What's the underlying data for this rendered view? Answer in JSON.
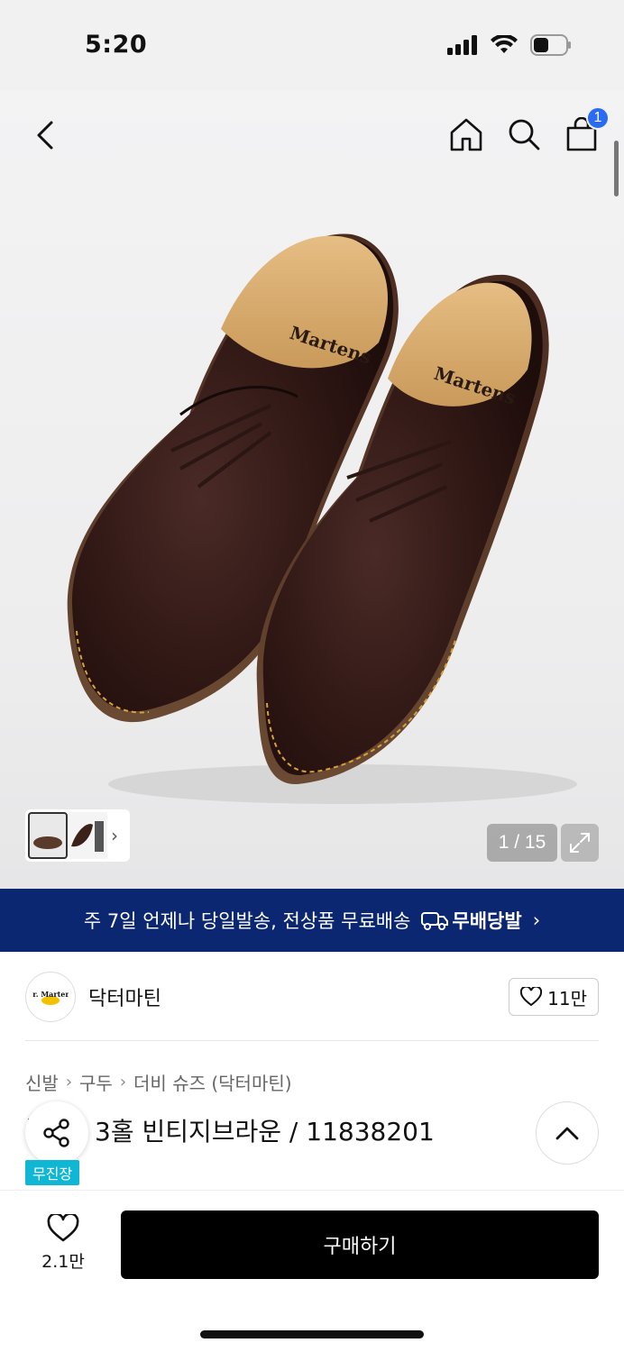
{
  "status_bar": {
    "time": "5:20"
  },
  "nav": {
    "cart_count": "1"
  },
  "gallery": {
    "counter": "1 / 15"
  },
  "promo": {
    "text": "주 7일 언제나 당일발송, 전상품 무료배송",
    "brand": "무배당발",
    "chevron": "›"
  },
  "brand": {
    "name": "닥터마틴",
    "likes": "11만",
    "logo_text": "Dr. Martens"
  },
  "breadcrumb": {
    "items": [
      "신발",
      "구두",
      "더비 슈즈 (닥터마틴)"
    ],
    "separator": "›"
  },
  "product": {
    "title_prefix": "1",
    "title": "3홀 빈티지브라운 / 11838201",
    "store_tag": "무진장"
  },
  "bottom_bar": {
    "wish_count": "2.1만",
    "buy_label": "구매하기"
  },
  "colors": {
    "banner_bg": "#0b2772",
    "badge": "#2a6bf2",
    "store_tag": "#10b7d4",
    "buy_button": "#000000"
  }
}
